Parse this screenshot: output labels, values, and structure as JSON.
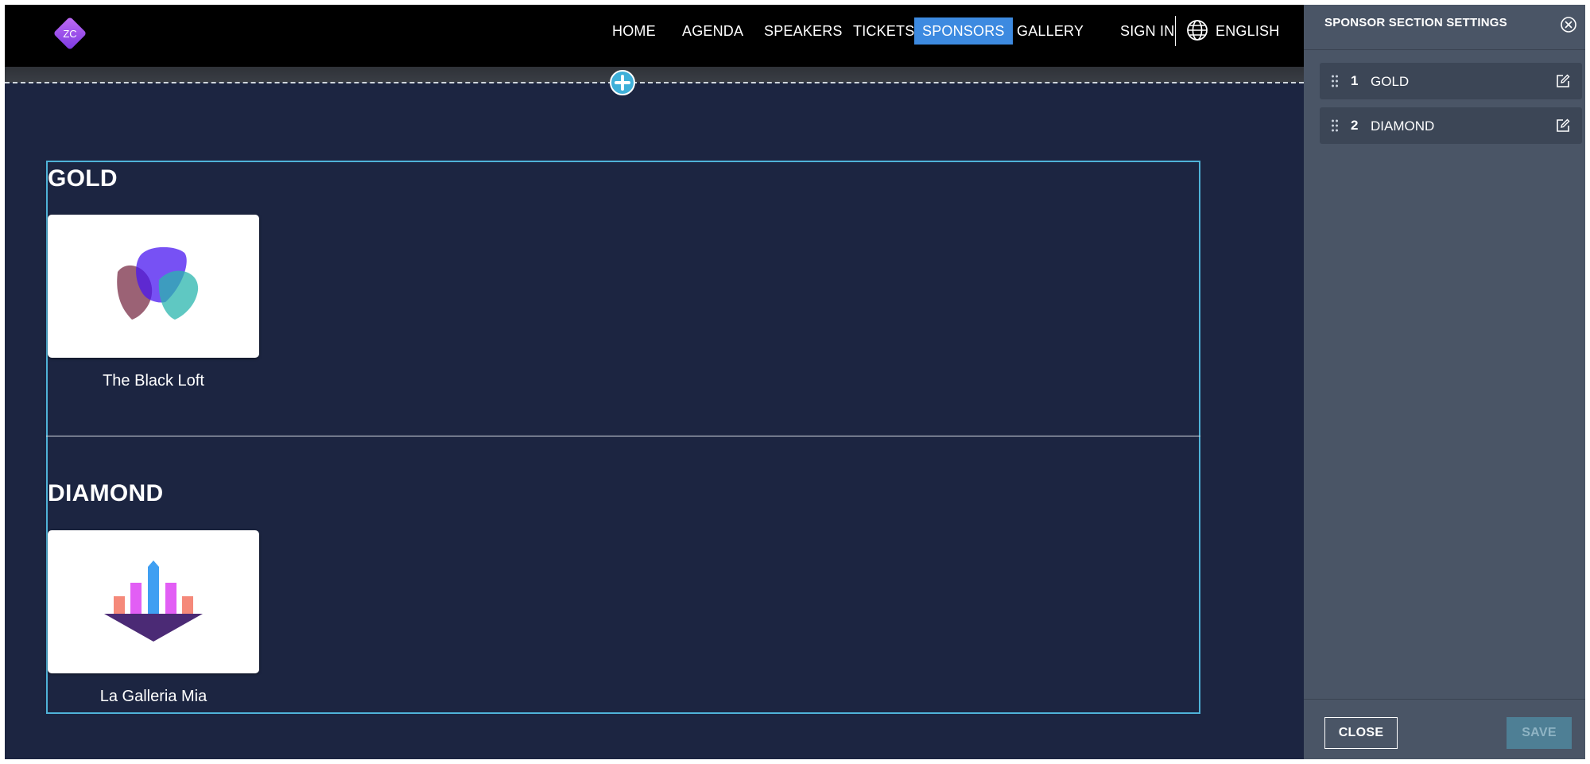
{
  "nav": {
    "items": [
      {
        "label": "HOME"
      },
      {
        "label": "AGENDA"
      },
      {
        "label": "SPEAKERS"
      },
      {
        "label": "TICKETS"
      },
      {
        "label": "SPONSORS",
        "active": true
      },
      {
        "label": "GALLERY"
      }
    ],
    "sign_in": "SIGN IN",
    "language": "ENGLISH",
    "logo_text": "ZC",
    "active_color": "#3d8ae0"
  },
  "sponsors": {
    "levels": [
      {
        "title": "GOLD",
        "sponsors": [
          {
            "name": "The Black Loft",
            "logo": "overlapping-petals-logo"
          }
        ]
      },
      {
        "title": "DIAMOND",
        "sponsors": [
          {
            "name": "La Galleria Mia",
            "logo": "bar-triangle-logo"
          }
        ]
      }
    ],
    "border_color": "#4fb3d8"
  },
  "panel": {
    "title": "SPONSOR SECTION SETTINGS",
    "rows": [
      {
        "number": "1",
        "label": "GOLD"
      },
      {
        "number": "2",
        "label": "DIAMOND"
      }
    ],
    "close_label": "CLOSE",
    "save_label": "SAVE"
  }
}
